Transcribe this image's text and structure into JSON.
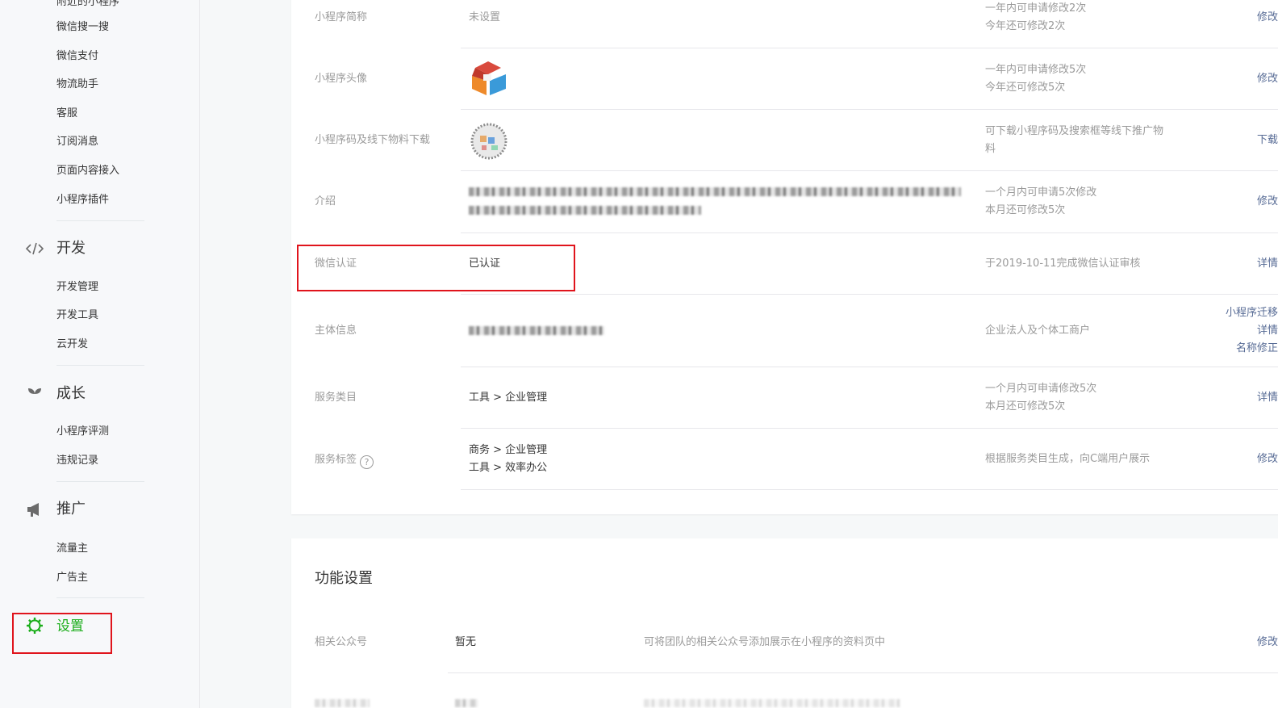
{
  "sidebar": {
    "top_items": [
      "附近的小程序",
      "微信搜一搜",
      "微信支付",
      "物流助手",
      "客服",
      "订阅消息",
      "页面内容接入",
      "小程序插件"
    ],
    "groups": [
      {
        "title": "开发",
        "icon": "code-icon",
        "items": [
          "开发管理",
          "开发工具",
          "云开发"
        ]
      },
      {
        "title": "成长",
        "icon": "sprout-icon",
        "items": [
          "小程序评测",
          "违规记录"
        ]
      },
      {
        "title": "推广",
        "icon": "megaphone-icon",
        "items": [
          "流量主",
          "广告主"
        ]
      },
      {
        "title": "设置",
        "icon": "gear-icon",
        "items": []
      }
    ],
    "active_color": "#1aad19"
  },
  "basic_info": {
    "rows": [
      {
        "label": "小程序简称",
        "value": "未设置",
        "notes": [
          "一年内可申请修改2次",
          "今年还可修改2次"
        ],
        "actions": [
          "修改"
        ]
      },
      {
        "label": "小程序头像",
        "value": "",
        "notes": [
          "一年内可申请修改5次",
          "今年还可修改5次"
        ],
        "actions": [
          "修改"
        ]
      },
      {
        "label": "小程序码及线下物料下载",
        "value": "",
        "notes": [
          "可下载小程序码及搜索框等线下推广物",
          "料"
        ],
        "actions": [
          "下载"
        ]
      },
      {
        "label": "介绍",
        "value": "",
        "notes": [
          "一个月内可申请5次修改",
          "本月还可修改5次"
        ],
        "actions": [
          "修改"
        ]
      },
      {
        "label": "微信认证",
        "value": "已认证",
        "notes": [
          "于2019-10-11完成微信认证审核"
        ],
        "actions": [
          "详情"
        ]
      },
      {
        "label": "主体信息",
        "value": "",
        "notes": [
          "企业法人及个体工商户"
        ],
        "actions": [
          "小程序迁移",
          "详情",
          "名称修正"
        ]
      },
      {
        "label": "服务类目",
        "value_lines": [
          "工具 > 企业管理"
        ],
        "notes": [
          "一个月内可申请修改5次",
          "本月还可修改5次"
        ],
        "actions": [
          "详情"
        ]
      },
      {
        "label": "服务标签",
        "value_lines": [
          "商务 > 企业管理",
          "工具 > 效率办公"
        ],
        "notes": [
          "根据服务类目生成，向C端用户展示"
        ],
        "actions": [
          "修改"
        ]
      }
    ]
  },
  "features": {
    "title": "功能设置",
    "rows": [
      {
        "label": "相关公众号",
        "value": "暂无",
        "note": "可将团队的相关公众号添加展示在小程序的资料页中",
        "action": "修改"
      }
    ]
  }
}
